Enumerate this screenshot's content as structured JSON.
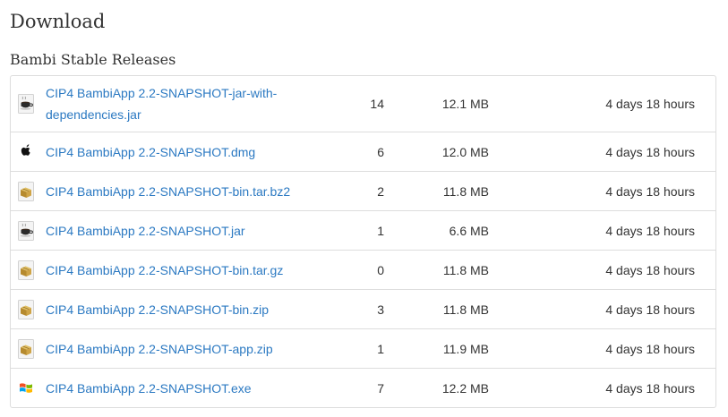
{
  "page": {
    "title": "Download",
    "section_title": "Bambi Stable Releases"
  },
  "colors": {
    "link": "#2b79c2",
    "text": "#333333",
    "border": "#dddddd"
  },
  "files": [
    {
      "icon": "java-coffee-icon",
      "name": "CIP4 BambiApp 2.2-SNAPSHOT-jar-with-dependencies.jar",
      "downloads": "14",
      "size": "12.1 MB",
      "age": "4 days 18 hours"
    },
    {
      "icon": "apple-icon",
      "name": "CIP4 BambiApp 2.2-SNAPSHOT.dmg",
      "downloads": "6",
      "size": "12.0 MB",
      "age": "4 days 18 hours"
    },
    {
      "icon": "archive-box-icon",
      "name": "CIP4 BambiApp 2.2-SNAPSHOT-bin.tar.bz2",
      "downloads": "2",
      "size": "11.8 MB",
      "age": "4 days 18 hours"
    },
    {
      "icon": "java-coffee-icon",
      "name": "CIP4 BambiApp 2.2-SNAPSHOT.jar",
      "downloads": "1",
      "size": "6.6 MB",
      "age": "4 days 18 hours"
    },
    {
      "icon": "archive-box-icon",
      "name": "CIP4 BambiApp 2.2-SNAPSHOT-bin.tar.gz",
      "downloads": "0",
      "size": "11.8 MB",
      "age": "4 days 18 hours"
    },
    {
      "icon": "archive-box-icon",
      "name": "CIP4 BambiApp 2.2-SNAPSHOT-bin.zip",
      "downloads": "3",
      "size": "11.8 MB",
      "age": "4 days 18 hours"
    },
    {
      "icon": "archive-box-icon",
      "name": "CIP4 BambiApp 2.2-SNAPSHOT-app.zip",
      "downloads": "1",
      "size": "11.9 MB",
      "age": "4 days 18 hours"
    },
    {
      "icon": "windows-flag-icon",
      "name": "CIP4 BambiApp 2.2-SNAPSHOT.exe",
      "downloads": "7",
      "size": "12.2 MB",
      "age": "4 days 18 hours"
    }
  ]
}
